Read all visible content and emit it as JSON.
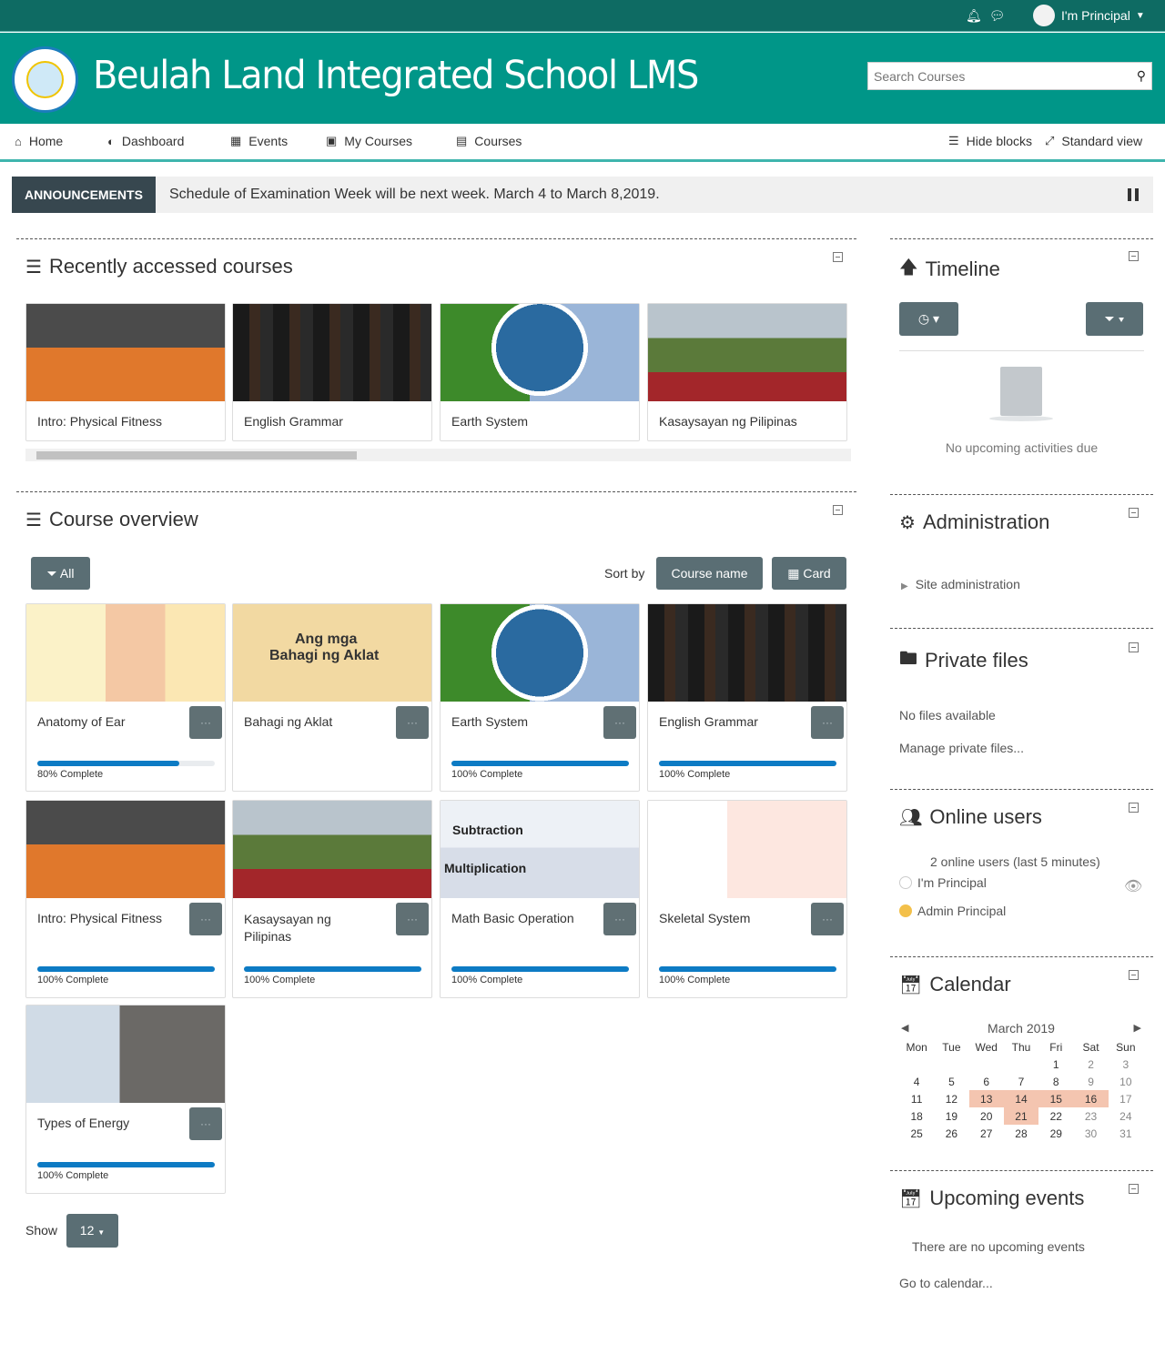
{
  "topbar": {
    "user": "I'm Principal"
  },
  "header": {
    "site_name": "Beulah Land Integrated School LMS",
    "search_placeholder": "Search Courses"
  },
  "nav": {
    "items": [
      {
        "label": "Home",
        "icon": "home-icon"
      },
      {
        "label": "Dashboard",
        "icon": "dashboard-icon"
      },
      {
        "label": "Events",
        "icon": "calendar-icon"
      },
      {
        "label": "My Courses",
        "icon": "briefcase-icon"
      },
      {
        "label": "Courses",
        "icon": "desktop-icon"
      }
    ],
    "hide_blocks": "Hide blocks",
    "standard_view": "Standard view"
  },
  "announcement": {
    "label": "ANNOUNCEMENTS",
    "message": "Schedule of Examination Week will be next week. March 4 to March 8,2019."
  },
  "recent": {
    "title": "Recently accessed courses",
    "courses": [
      "Intro: Physical Fitness",
      "English Grammar",
      "Earth System",
      "Kasaysayan ng Pilipinas"
    ]
  },
  "overview": {
    "title": "Course overview",
    "filter": "All",
    "sort_by": "Sort by",
    "sort_value": "Course name",
    "view_value": "Card",
    "show_label": "Show",
    "show_value": "12",
    "courses": [
      {
        "name": "Anatomy of Ear",
        "progress": 80,
        "label": "80% Complete"
      },
      {
        "name": "Bahagi ng Aklat",
        "progress": null,
        "label": ""
      },
      {
        "name": "Earth System",
        "progress": 100,
        "label": "100% Complete"
      },
      {
        "name": "English Grammar",
        "progress": 100,
        "label": "100% Complete"
      },
      {
        "name": "Intro: Physical Fitness",
        "progress": 100,
        "label": "100% Complete"
      },
      {
        "name": "Kasaysayan ng Pilipinas",
        "progress": 100,
        "label": "100% Complete"
      },
      {
        "name": "Math Basic Operation",
        "progress": 100,
        "label": "100% Complete"
      },
      {
        "name": "Skeletal System",
        "progress": 100,
        "label": "100% Complete"
      },
      {
        "name": "Types of Energy",
        "progress": 100,
        "label": "100% Complete"
      }
    ],
    "image_text": {
      "bahagi_line1": "Ang mga",
      "bahagi_line2": "Bahagi ng Aklat",
      "math_sub": "Subtraction",
      "math_mul": "Multiplication"
    }
  },
  "timeline": {
    "title": "Timeline",
    "empty": "No upcoming activities due"
  },
  "administration": {
    "title": "Administration",
    "item": "Site administration"
  },
  "private_files": {
    "title": "Private files",
    "empty": "No files available",
    "manage": "Manage private files..."
  },
  "online_users": {
    "title": "Online users",
    "summary": "2 online users (last 5 minutes)",
    "users": [
      "I'm Principal",
      "Admin Principal"
    ]
  },
  "calendar": {
    "title": "Calendar",
    "month": "March 2019",
    "days": [
      "Mon",
      "Tue",
      "Wed",
      "Thu",
      "Fri",
      "Sat",
      "Sun"
    ],
    "weeks": [
      [
        "",
        "",
        "",
        "",
        "1",
        "2",
        "3"
      ],
      [
        "4",
        "5",
        "6",
        "7",
        "8",
        "9",
        "10"
      ],
      [
        "11",
        "12",
        "13",
        "14",
        "15",
        "16",
        "17"
      ],
      [
        "18",
        "19",
        "20",
        "21",
        "22",
        "23",
        "24"
      ],
      [
        "25",
        "26",
        "27",
        "28",
        "29",
        "30",
        "31"
      ]
    ],
    "highlighted": [
      "13",
      "14",
      "15",
      "16",
      "21"
    ]
  },
  "upcoming": {
    "title": "Upcoming events",
    "empty": "There are no upcoming events",
    "link": "Go to calendar..."
  }
}
